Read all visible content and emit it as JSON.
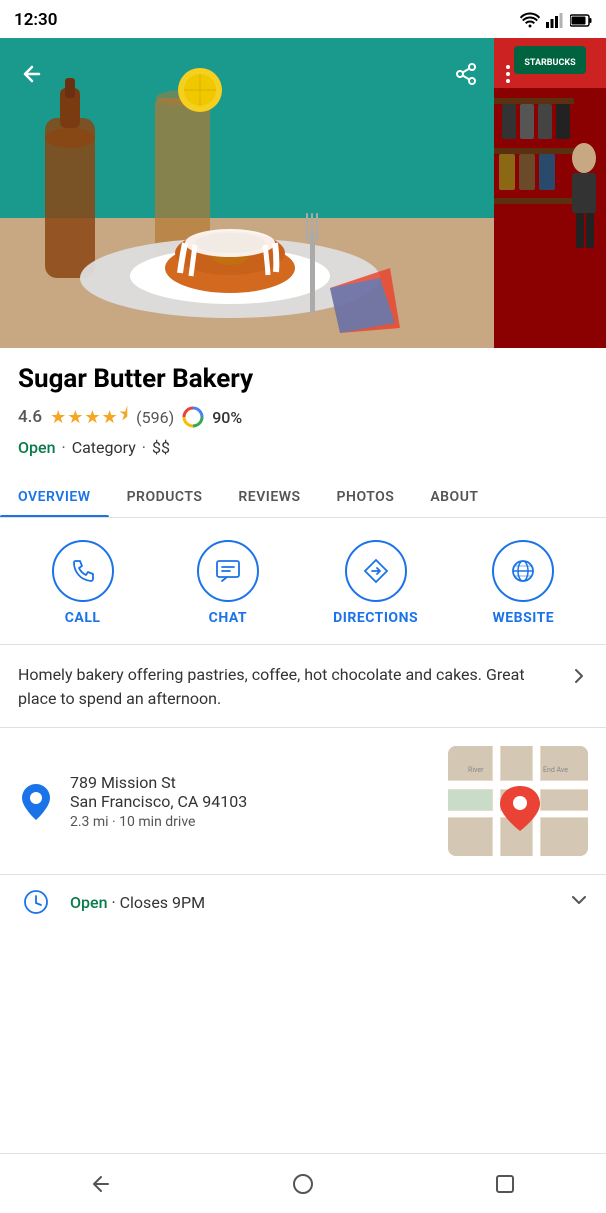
{
  "statusBar": {
    "time": "12:30"
  },
  "hero": {
    "backIcon": "←",
    "shareIcon": "share",
    "moreIcon": "⋮"
  },
  "place": {
    "name": "Sugar Butter Bakery",
    "rating": "4.6",
    "reviewCount": "(596)",
    "popularity": "90%",
    "status": "Open",
    "category": "Category",
    "price": "$$"
  },
  "tabs": [
    {
      "label": "OVERVIEW",
      "active": true
    },
    {
      "label": "PRODUCTS",
      "active": false
    },
    {
      "label": "REVIEWS",
      "active": false
    },
    {
      "label": "PHOTOS",
      "active": false
    },
    {
      "label": "ABOUT",
      "active": false
    }
  ],
  "actions": [
    {
      "id": "call",
      "label": "CALL",
      "icon": "phone"
    },
    {
      "id": "chat",
      "label": "CHAT",
      "icon": "chat"
    },
    {
      "id": "directions",
      "label": "DIRECTIONS",
      "icon": "directions"
    },
    {
      "id": "website",
      "label": "WEBSITE",
      "icon": "globe"
    }
  ],
  "description": "Homely bakery offering pastries, coffee, hot chocolate and cakes. Great place to spend an afternoon.",
  "address": {
    "line1": "789 Mission St",
    "line2": "San Francisco, CA 94103",
    "distance": "2.3 mi · 10 min drive"
  },
  "hours": {
    "status": "Open",
    "closes": "Closes 9PM"
  },
  "bottomNav": {
    "back": "◁",
    "home": "○",
    "recent": "□"
  }
}
